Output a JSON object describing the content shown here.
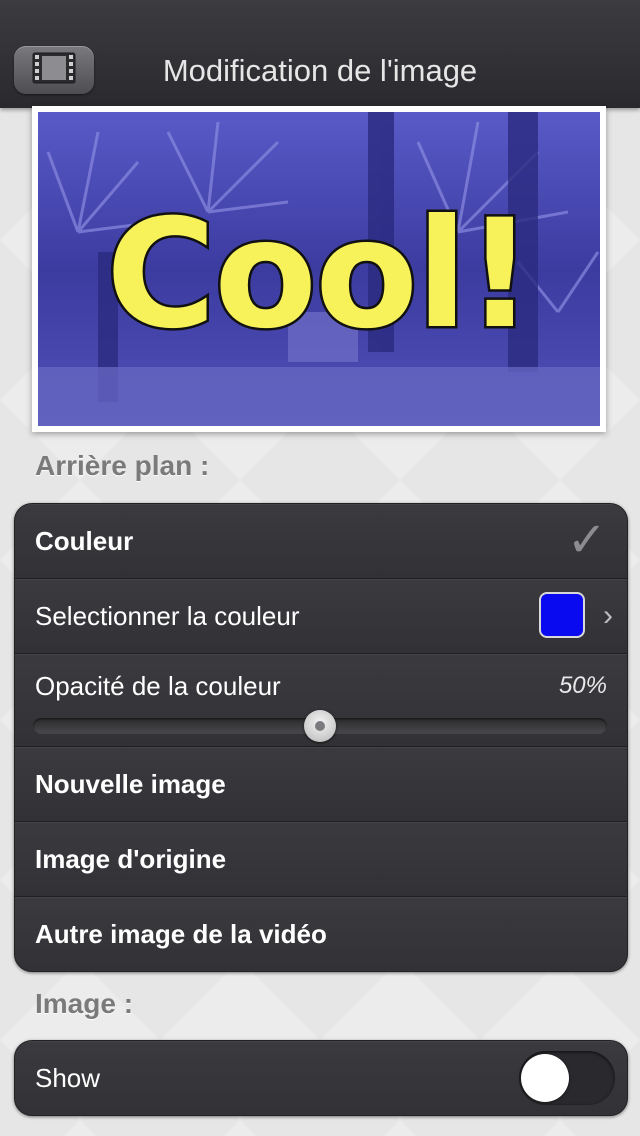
{
  "header": {
    "title": "Modification de l'image",
    "back_icon": "film-strip-icon"
  },
  "preview": {
    "overlay_text": "Cool!",
    "tint_color": "#0000ff"
  },
  "background_section": {
    "title": "Arrière plan :",
    "items": {
      "color": {
        "label": "Couleur",
        "checked": true
      },
      "select_color": {
        "label": "Selectionner la couleur",
        "swatch": "#0a0af0"
      },
      "opacity": {
        "label": "Opacité de la couleur",
        "value_text": "50%",
        "value": 0.5
      },
      "new_image": {
        "label": "Nouvelle image"
      },
      "original_image": {
        "label": "Image d'origine"
      },
      "other_video_image": {
        "label": "Autre image de la vidéo"
      }
    }
  },
  "image_section": {
    "title": "Image :",
    "show": {
      "label": "Show",
      "on": false
    }
  }
}
